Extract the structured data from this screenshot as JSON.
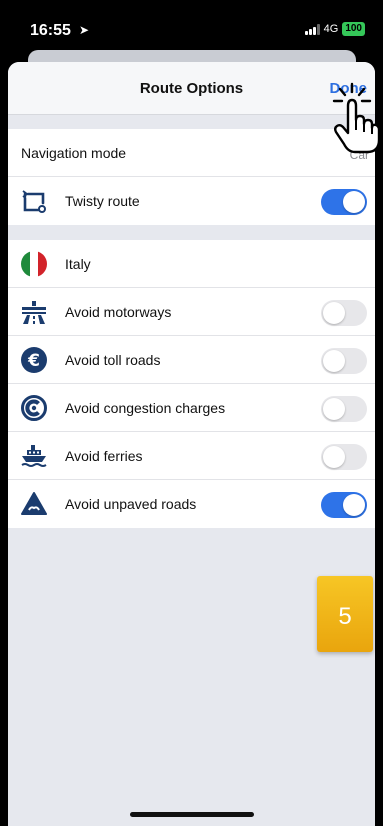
{
  "status_bar": {
    "time": "16:55",
    "network": "4G",
    "battery": "100"
  },
  "nav": {
    "title": "Route Options",
    "done_label": "Done"
  },
  "section1": {
    "navigation_mode_label": "Navigation mode",
    "navigation_mode_value": "Car",
    "twisty_label": "Twisty route",
    "twisty_on": true
  },
  "section2": {
    "country_label": "Italy",
    "options": [
      {
        "label": "Avoid motorways",
        "icon": "motorway-icon",
        "on": false
      },
      {
        "label": "Avoid toll roads",
        "icon": "euro-icon",
        "on": false
      },
      {
        "label": "Avoid congestion charges",
        "icon": "congestion-charge-icon",
        "on": false
      },
      {
        "label": "Avoid ferries",
        "icon": "ferry-icon",
        "on": false
      },
      {
        "label": "Avoid unpaved roads",
        "icon": "unpaved-road-icon",
        "on": true
      }
    ]
  },
  "step_badge": "5",
  "colors": {
    "accent": "#2e73e8",
    "icon_navy": "#1b3c6e",
    "badge": "#f2b51a"
  }
}
